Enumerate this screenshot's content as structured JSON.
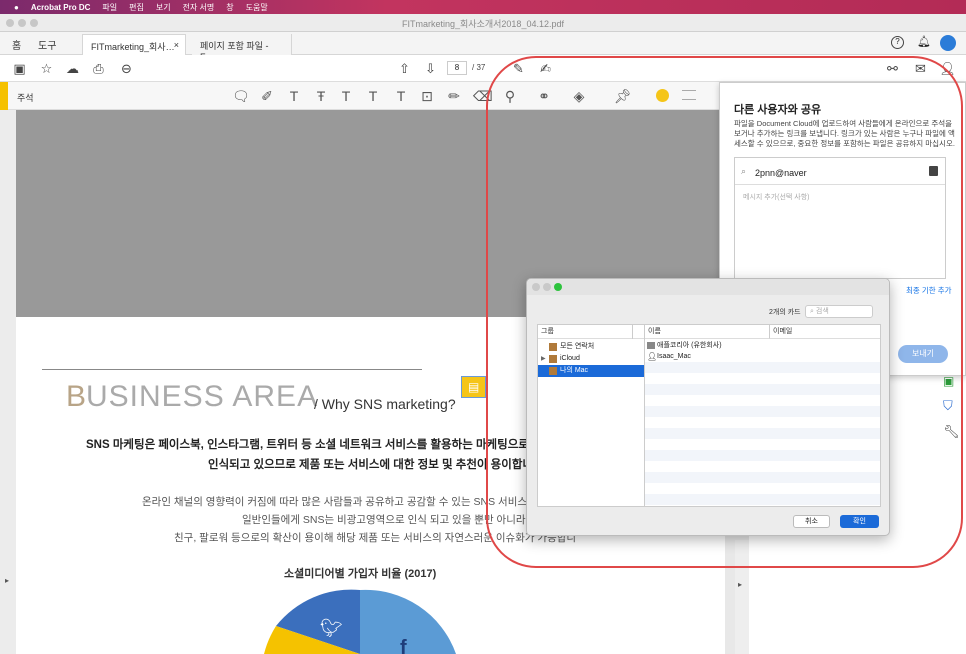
{
  "menubar": {
    "apple": "",
    "app": "Acrobat Pro DC",
    "items": [
      "파일",
      "편집",
      "보기",
      "전자 서명",
      "창",
      "도움말"
    ]
  },
  "window": {
    "title": "FITmarketing_회사소개서2018_04.12.pdf"
  },
  "nav": {
    "home": "홈",
    "tools": "도구"
  },
  "tabs": [
    {
      "label": "FITmarketing_회사…",
      "close": "×"
    },
    {
      "label": "페이지 포함 파일 - F…"
    }
  ],
  "toolbar": {
    "page": "8",
    "total": "/ 37"
  },
  "commentbar": {
    "label": "주석"
  },
  "doc": {
    "heading_first": "B",
    "heading_rest": "USINESS AREA",
    "why": "/ Why SNS marketing?",
    "bold1": "SNS 마케팅은 페이스북, 인스타그램, 트위터 등 소셜 네트워크 서비스를 활용하는 마케팅으로, 일",
    "bold2": "인식되고 있으므로  제품 또는 서비스에 대한 정보 및 추천이 용이합니",
    "p1": "온라인 채널의 영향력이 커짐에 따라 많은 사람들과 공유하고 공감할 수 있는 SNS 서비스도 급",
    "p2": "일반인들에게 SNS는 비광고영역으로 인식 되고 있을 뿐만 아니라",
    "p3": "친구, 팔로워 등으로의 확산이 용이해 해당 제품 또는 서비스의 자연스러운 이슈화가 가능합니",
    "chart_title": "소셜미디어별 가입자 비율 (2017)"
  },
  "share": {
    "title": "다른 사용자와 공유",
    "desc": "파일을 Document Cloud에 업로드하여 사람들에게 온라인으로 주석을 보거나 추가하는 링크를 보냅니다. 링크가 있는 사람은 누구나 파일에 액세스할 수 있으므로, 중요한 정보를 포함하는 파일은 공유하지 마십시오.",
    "input": "2pnn@naver",
    "message_placeholder": "메시지 추가(선택 사항)",
    "deadline": "최종 기한 추가",
    "send": "보내기"
  },
  "contacts": {
    "card_count": "2개의 카드",
    "search_placeholder": "검색",
    "col_group": "그룹",
    "col_name": "이름",
    "col_email": "이메일",
    "groups": [
      "모든 연락처",
      "iCloud",
      "나의 Mac"
    ],
    "names": [
      "애플코리아 (유한회사)",
      "Isaac_Mac"
    ],
    "cancel": "취소",
    "ok": "확인"
  },
  "colors": {
    "highlight": "#e04848",
    "accent": "#1b6ad8",
    "yellow": "#f5c518"
  }
}
